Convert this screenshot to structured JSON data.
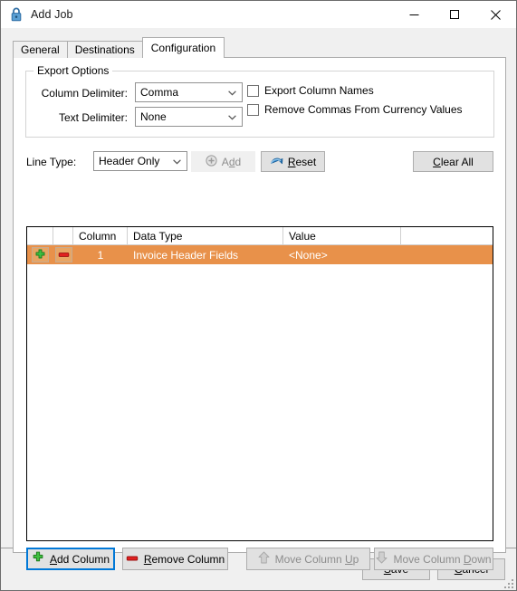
{
  "window": {
    "title": "Add Job",
    "icon": "lock-icon",
    "controls": {
      "minimize": "minimize-icon",
      "maximize": "maximize-icon",
      "close": "close-icon"
    }
  },
  "tabs": [
    {
      "label": "General",
      "active": false
    },
    {
      "label": "Destinations",
      "active": false
    },
    {
      "label": "Configuration",
      "active": true
    }
  ],
  "export_options": {
    "legend": "Export Options",
    "column_delimiter": {
      "label": "Column Delimiter:",
      "value": "Comma"
    },
    "text_delimiter": {
      "label": "Text Delimiter:",
      "value": "None"
    },
    "checkboxes": [
      {
        "label": "Export Column Names",
        "checked": false
      },
      {
        "label": "Remove Commas From Currency Values",
        "checked": false
      }
    ]
  },
  "line_type": {
    "label": "Line Type:",
    "value": "Header Only",
    "add_button": {
      "label": "Add",
      "accel": "d",
      "enabled": false,
      "icon": "plus-circle-icon"
    },
    "reset_button": {
      "label": "Reset",
      "accel": "R",
      "enabled": true,
      "icon": "reset-arrow-icon"
    },
    "clear_all_button": {
      "label": "Clear All",
      "accel": "C",
      "enabled": true
    }
  },
  "grid": {
    "headers": [
      "",
      "",
      "Column",
      "Data Type",
      "Value",
      ""
    ],
    "rows": [
      {
        "add_icon": "green-plus-icon",
        "remove_icon": "red-minus-icon",
        "column": "1",
        "data_type": "Invoice Header Fields",
        "value": "<None>",
        "selected": true
      }
    ]
  },
  "column_toolbar": [
    {
      "label": "Add Column",
      "accel": "A",
      "icon": "green-plus-icon",
      "enabled": true,
      "focused": true
    },
    {
      "label": "Remove Column",
      "accel": "R",
      "icon": "red-minus-icon",
      "enabled": true,
      "focused": false
    },
    {
      "label": "Move Column Up",
      "accel": "U",
      "icon": "arrow-up-icon",
      "enabled": false,
      "focused": false
    },
    {
      "label": "Move Column Down",
      "accel": "D",
      "icon": "arrow-down-icon",
      "enabled": false,
      "focused": false
    }
  ],
  "footer": {
    "save": "Save",
    "cancel": "Cancel"
  },
  "colors": {
    "selected_row": "#e8914a",
    "focus_blue": "#0078d7",
    "green_plus": "#32c832",
    "red_minus": "#e02020"
  }
}
